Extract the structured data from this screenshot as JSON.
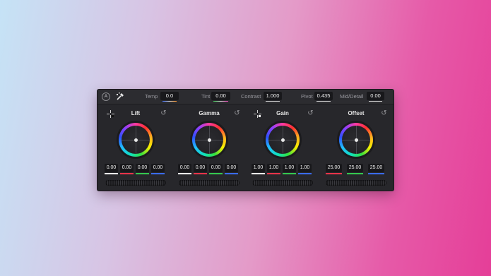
{
  "colors": {
    "white": "#f0f0f0",
    "red": "#e8344a",
    "green": "#35c84f",
    "blue": "#3a6cff",
    "accent_line": "#d0d0d0"
  },
  "toolbar": {
    "auto_label": "A",
    "picker_icon": "color-picker-icon",
    "temp_label": "Temp",
    "temp_value": "0.0",
    "tint_label": "Tint",
    "tint_value": "0.00",
    "contrast_label": "Contrast",
    "contrast_value": "1.000",
    "pivot_label": "Pivot",
    "pivot_value": "0.435",
    "middetail_label": "Mid/Detail",
    "middetail_value": "0.00"
  },
  "wheels": [
    {
      "title": "Lift",
      "picker_icon": "black-point-picker-icon",
      "values": [
        "0.00",
        "0.00",
        "0.00",
        "0.00"
      ]
    },
    {
      "title": "Gamma",
      "values": [
        "0.00",
        "0.00",
        "0.00",
        "0.00"
      ]
    },
    {
      "title": "Gain",
      "picker_icon": "white-point-picker-icon",
      "values": [
        "1.00",
        "1.00",
        "1.00",
        "1.00"
      ]
    },
    {
      "title": "Offset",
      "values": [
        "25.00",
        "25.00",
        "25.00"
      ]
    }
  ],
  "reset_icon": "reset-icon",
  "reset_glyph": "↺"
}
